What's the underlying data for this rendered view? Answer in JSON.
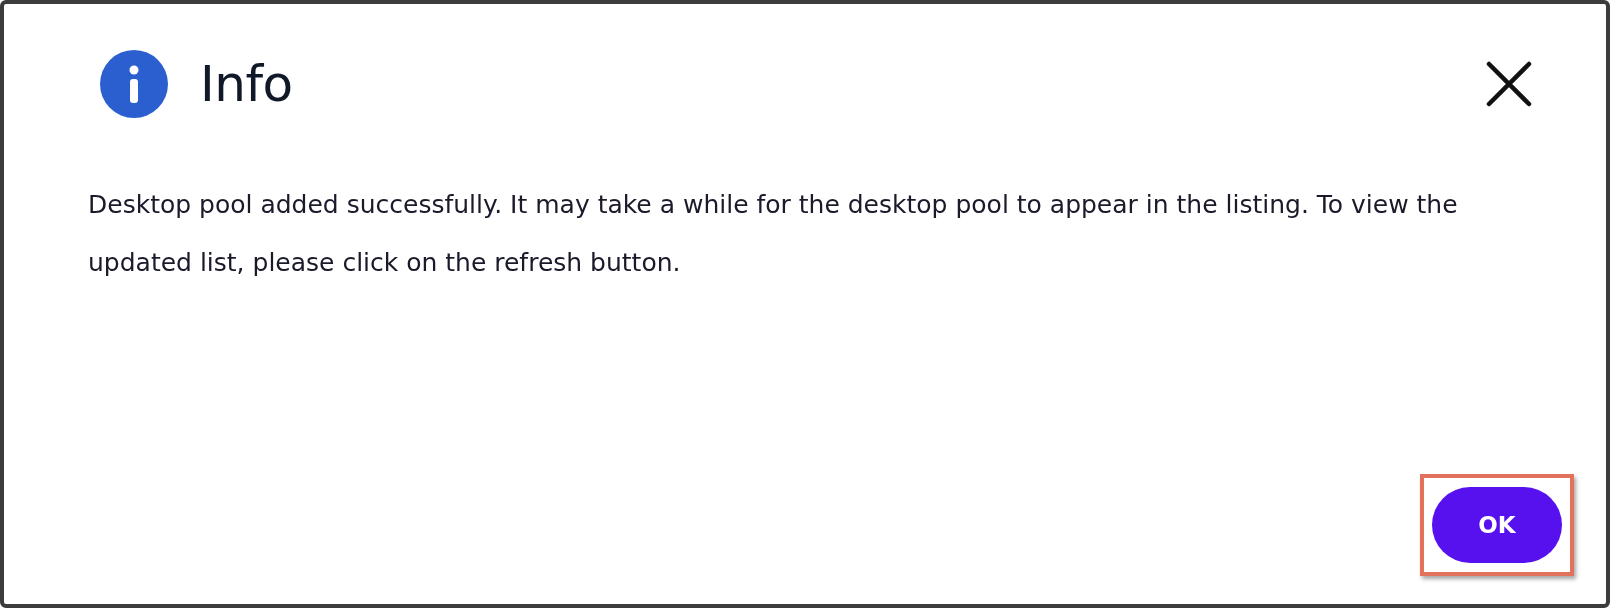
{
  "dialog": {
    "title": "Info",
    "message": "Desktop pool added successfully. It may take a while for the desktop pool to appear in the listing. To view the updated list, please click on the refresh button.",
    "buttons": [
      {
        "label": "OK",
        "highlighted": true
      }
    ]
  }
}
